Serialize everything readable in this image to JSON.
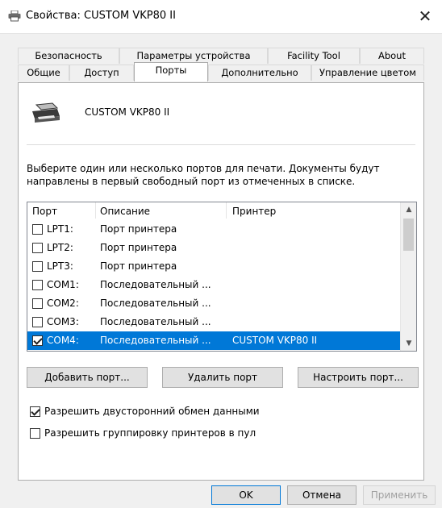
{
  "window": {
    "title": "Свойства: CUSTOM VKP80 II",
    "close_symbol": "✕"
  },
  "tabs_row1": [
    "Безопасность",
    "Параметры устройства",
    "Facility Tool",
    "About"
  ],
  "tabs_row2": [
    "Общие",
    "Доступ",
    "Порты",
    "Дополнительно",
    "Управление цветом"
  ],
  "active_tab": "Порты",
  "printer": {
    "name": "CUSTOM VKP80 II",
    "icon": "printer-icon"
  },
  "instructions": "Выберите один или несколько портов для печати. Документы будут направлены в первый свободный порт из отмеченных в списке.",
  "ports_table": {
    "headers": {
      "port": "Порт",
      "description": "Описание",
      "printer": "Принтер"
    },
    "rows": [
      {
        "checked": false,
        "port": "LPT1:",
        "description": "Порт принтера",
        "printer": "",
        "selected": false
      },
      {
        "checked": false,
        "port": "LPT2:",
        "description": "Порт принтера",
        "printer": "",
        "selected": false
      },
      {
        "checked": false,
        "port": "LPT3:",
        "description": "Порт принтера",
        "printer": "",
        "selected": false
      },
      {
        "checked": false,
        "port": "COM1:",
        "description": "Последовательный ...",
        "printer": "",
        "selected": false
      },
      {
        "checked": false,
        "port": "COM2:",
        "description": "Последовательный ...",
        "printer": "",
        "selected": false
      },
      {
        "checked": false,
        "port": "COM3:",
        "description": "Последовательный ...",
        "printer": "",
        "selected": false
      },
      {
        "checked": true,
        "port": "COM4:",
        "description": "Последовательный ...",
        "printer": "CUSTOM VKP80 II",
        "selected": true
      }
    ]
  },
  "port_buttons": {
    "add": "Добавить порт...",
    "delete": "Удалить порт",
    "configure": "Настроить порт..."
  },
  "options": {
    "bidirectional": {
      "label": "Разрешить двусторонний обмен данными",
      "checked": true
    },
    "pooling": {
      "label": "Разрешить группировку принтеров в пул",
      "checked": false
    }
  },
  "dialog_buttons": {
    "ok": "OK",
    "cancel": "Отмена",
    "apply": "Применить"
  },
  "colors": {
    "selection": "#0078d7",
    "dialog_bg": "#f0f0f0"
  }
}
